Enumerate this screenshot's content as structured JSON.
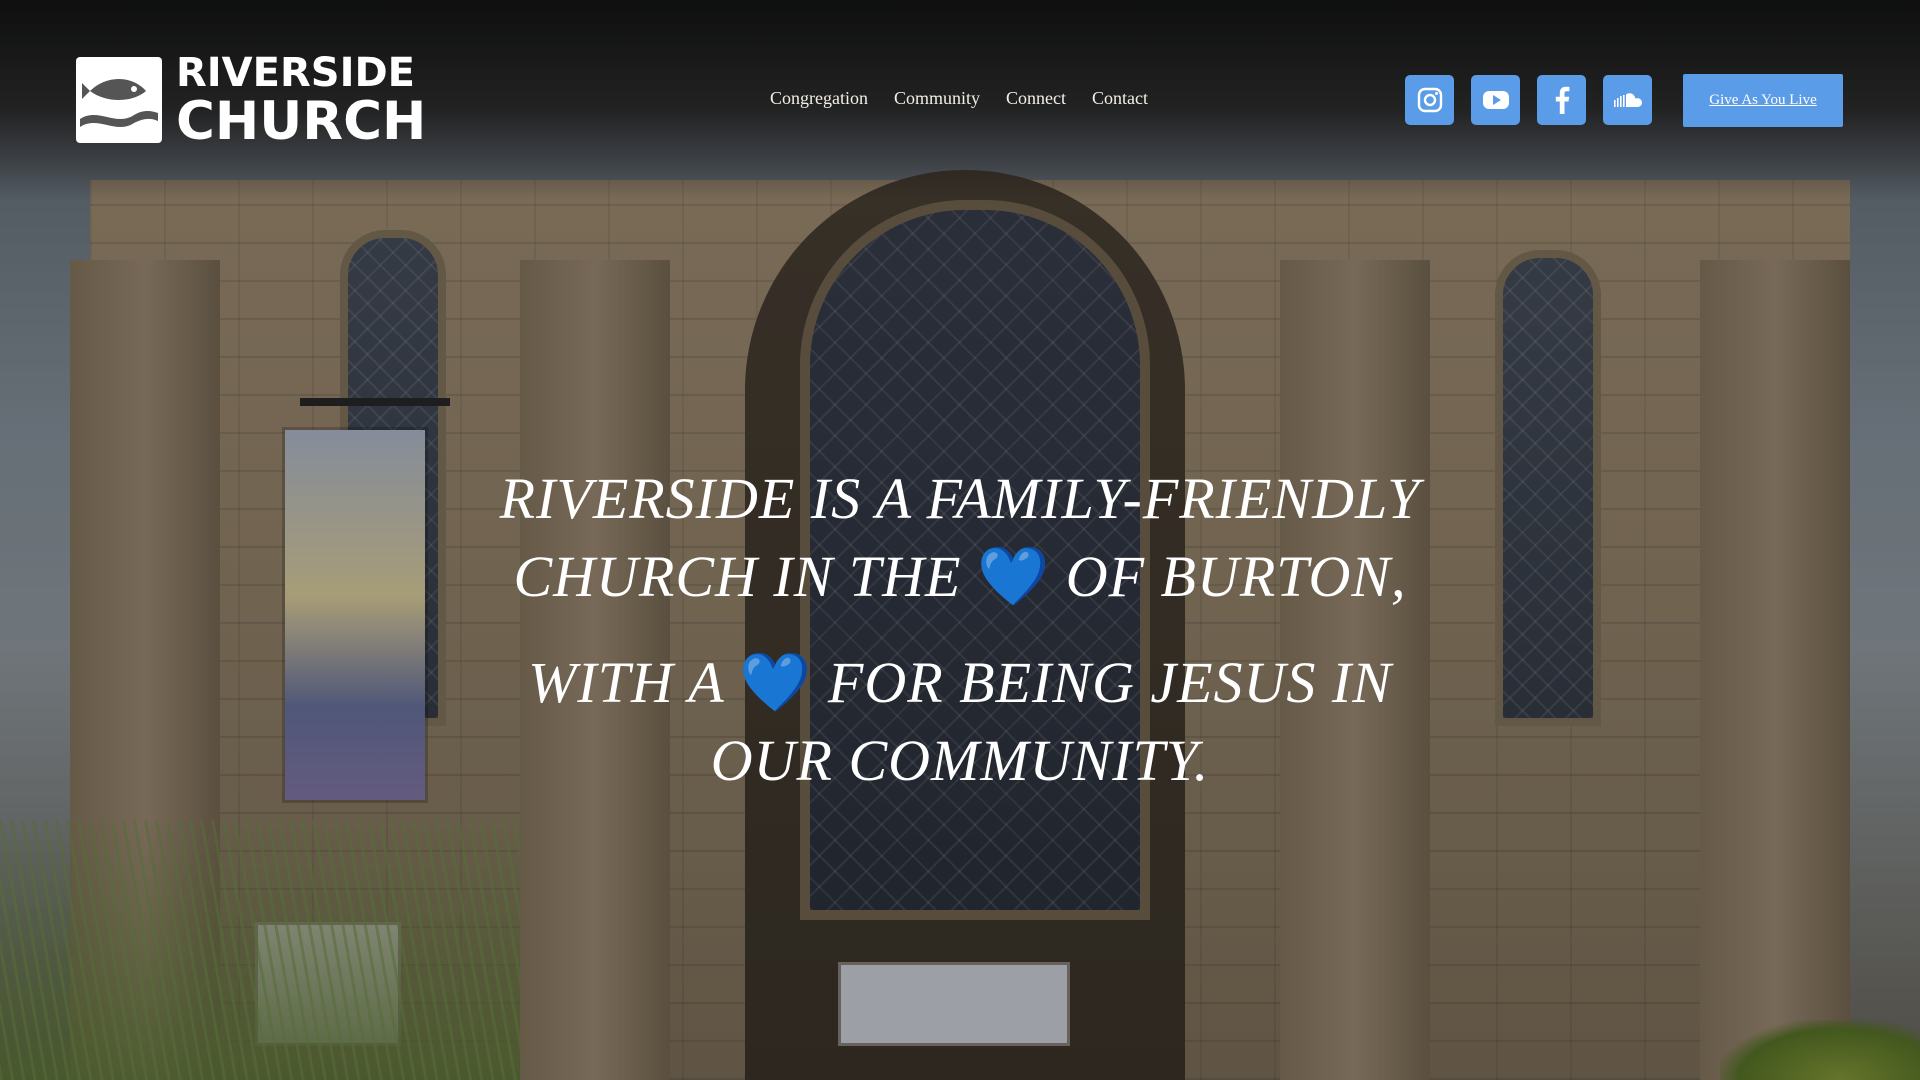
{
  "brand": {
    "logo_line1": "RIVERSIDE",
    "logo_line2": "CHURCH",
    "accent_color": "#5b9ce8"
  },
  "nav": {
    "items": [
      {
        "label": "Congregation"
      },
      {
        "label": "Community"
      },
      {
        "label": "Connect"
      },
      {
        "label": "Contact"
      }
    ]
  },
  "socials": [
    {
      "icon": "instagram-icon"
    },
    {
      "icon": "youtube-icon"
    },
    {
      "icon": "facebook-icon"
    },
    {
      "icon": "soundcloud-icon"
    }
  ],
  "cta": {
    "give_label": "Give As You Live"
  },
  "hero": {
    "line1": "RIVERSIDE IS A FAMILY-FRIENDLY",
    "line2_a": "CHURCH IN THE",
    "heart1": "💙",
    "line2_b": "OF BURTON,",
    "line3_a": "WITH A",
    "heart2": "💙",
    "line3_b": "FOR BEING JESUS IN",
    "line4": "OUR COMMUNITY."
  }
}
